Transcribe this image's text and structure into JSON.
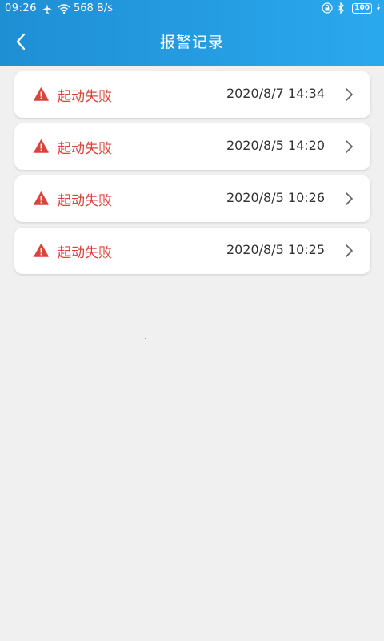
{
  "status_bar": {
    "time": "09:26",
    "net_speed": "568 B/s",
    "battery": "100",
    "icons": [
      "airplane-icon",
      "wifi-icon",
      "lock-icon",
      "bluetooth-icon",
      "battery-icon",
      "charging-icon"
    ]
  },
  "header": {
    "title": "报警记录",
    "back_icon": "chevron-left-icon",
    "colors": {
      "gradient_start": "#1f8fd4",
      "gradient_end": "#2aa8ee"
    }
  },
  "alarms": [
    {
      "status": "起动失败",
      "time": "2020/8/7 14:34"
    },
    {
      "status": "起动失败",
      "time": "2020/8/5 14:20"
    },
    {
      "status": "起动失败",
      "time": "2020/8/5 10:26"
    },
    {
      "status": "起动失败",
      "time": "2020/8/5 10:25"
    }
  ],
  "colors": {
    "alarm_text": "#d8453c",
    "background": "#f0f0f0",
    "card": "#ffffff"
  }
}
